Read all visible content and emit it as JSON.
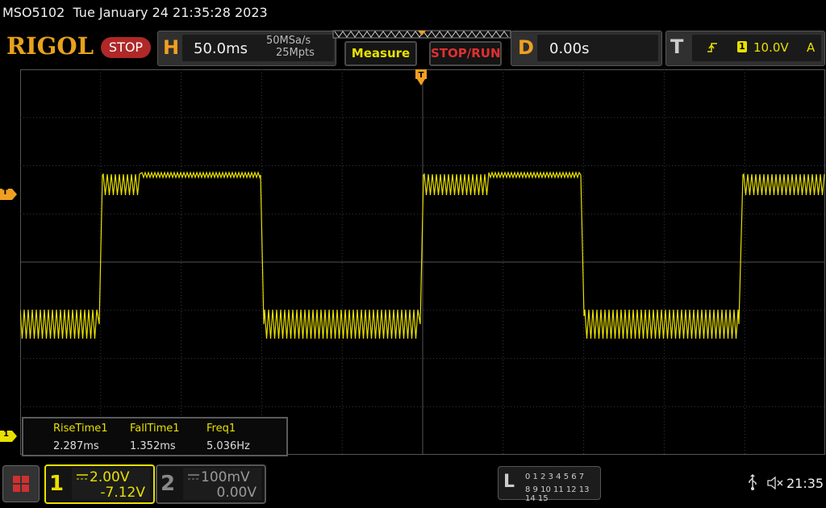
{
  "titlebar": {
    "model": "MSO5102",
    "datetime": "Tue January 24 21:35:28 2023"
  },
  "toolbar": {
    "logo": "RIGOL",
    "run_state": "STOP",
    "horizontal": {
      "letter": "H",
      "timebase": "50.0ms",
      "sample_rate": "50MSa/s",
      "memory_depth": "25Mpts"
    },
    "measure_label": "Measure",
    "stoprun_label": "STOP/RUN",
    "delay": {
      "letter": "D",
      "value": "0.00s"
    },
    "trigger": {
      "letter": "T",
      "source": "1",
      "level": "10.0V",
      "mode": "A"
    }
  },
  "markers": {
    "trigger_level": "T",
    "ch1_ground": "1"
  },
  "measurements": [
    {
      "name": "RiseTime1",
      "value": "2.287ms"
    },
    {
      "name": "FallTime1",
      "value": "1.352ms"
    },
    {
      "name": "Freq1",
      "value": "5.036Hz"
    }
  ],
  "channels": [
    {
      "number": "1",
      "scale": "2.00V",
      "offset": "-7.12V",
      "color": "#e8e000"
    },
    {
      "number": "2",
      "scale": "100mV",
      "offset": "0.00V",
      "color": "#888888"
    }
  ],
  "logic": {
    "letter": "L",
    "row1": "0 1 2 3   4 5 6 7",
    "row2": "8 9 10 11 12 13 14 15"
  },
  "status": {
    "time": "21:35"
  },
  "colors": {
    "trace": "#e8e000",
    "accent": "#f0a020",
    "stop": "#b02828"
  }
}
